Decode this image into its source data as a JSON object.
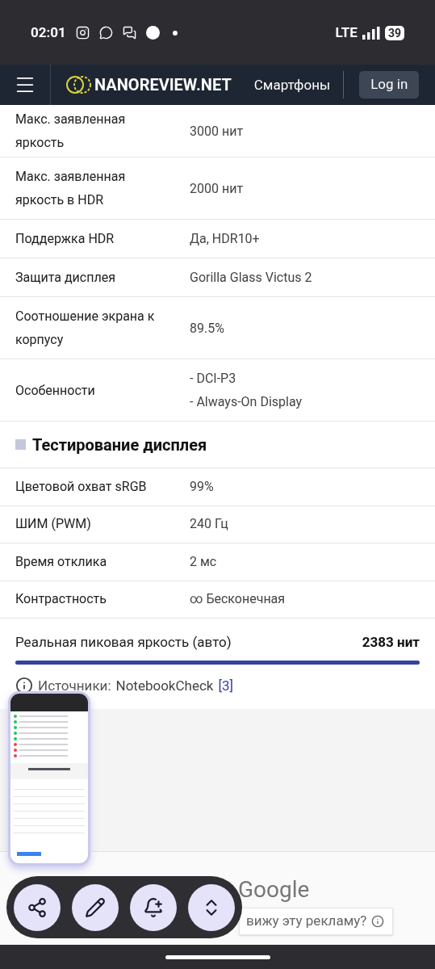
{
  "status_bar": {
    "time": "02:01",
    "network": "LTE",
    "battery": "39"
  },
  "nav": {
    "logo": "NANOREVIEW.NET",
    "link": "Смартфоны",
    "login": "Log in"
  },
  "spec_rows": [
    {
      "label": "Макс. заявленная яркость",
      "values": [
        "3000 нит"
      ]
    },
    {
      "label": "Макс. заявленная яркость в HDR",
      "values": [
        "2000 нит"
      ]
    },
    {
      "label": "Поддержка HDR",
      "values": [
        "Да, HDR10+"
      ]
    },
    {
      "label": "Защита дисплея",
      "values": [
        "Gorilla Glass Victus 2"
      ]
    },
    {
      "label": "Соотношение экрана к корпусу",
      "values": [
        "89.5%"
      ]
    },
    {
      "label": "Особенности",
      "values": [
        "- DCI-P3",
        "- Always-On Display"
      ]
    }
  ],
  "section": {
    "title": "Тестирование дисплея"
  },
  "test_rows": [
    {
      "label": "Цветовой охват sRGB",
      "value": "99%"
    },
    {
      "label": "ШИМ (PWM)",
      "value": "240 Гц"
    },
    {
      "label": "Время отклика",
      "value": "2 мс"
    },
    {
      "label": "Контрастность",
      "value": "∞ Бесконечная"
    }
  ],
  "peak": {
    "label": "Реальная пиковая яркость (авто)",
    "value": "2383 нит",
    "level": 1
  },
  "sources": {
    "label": "Источники:",
    "source": "NotebookCheck",
    "ref": "[3]"
  },
  "ad": {
    "title": "Google",
    "button": "вижу эту рекламу?"
  },
  "floating_toolbar": [
    {
      "kind": "share"
    },
    {
      "kind": "edit"
    },
    {
      "kind": "bell"
    },
    {
      "kind": "expand"
    }
  ]
}
